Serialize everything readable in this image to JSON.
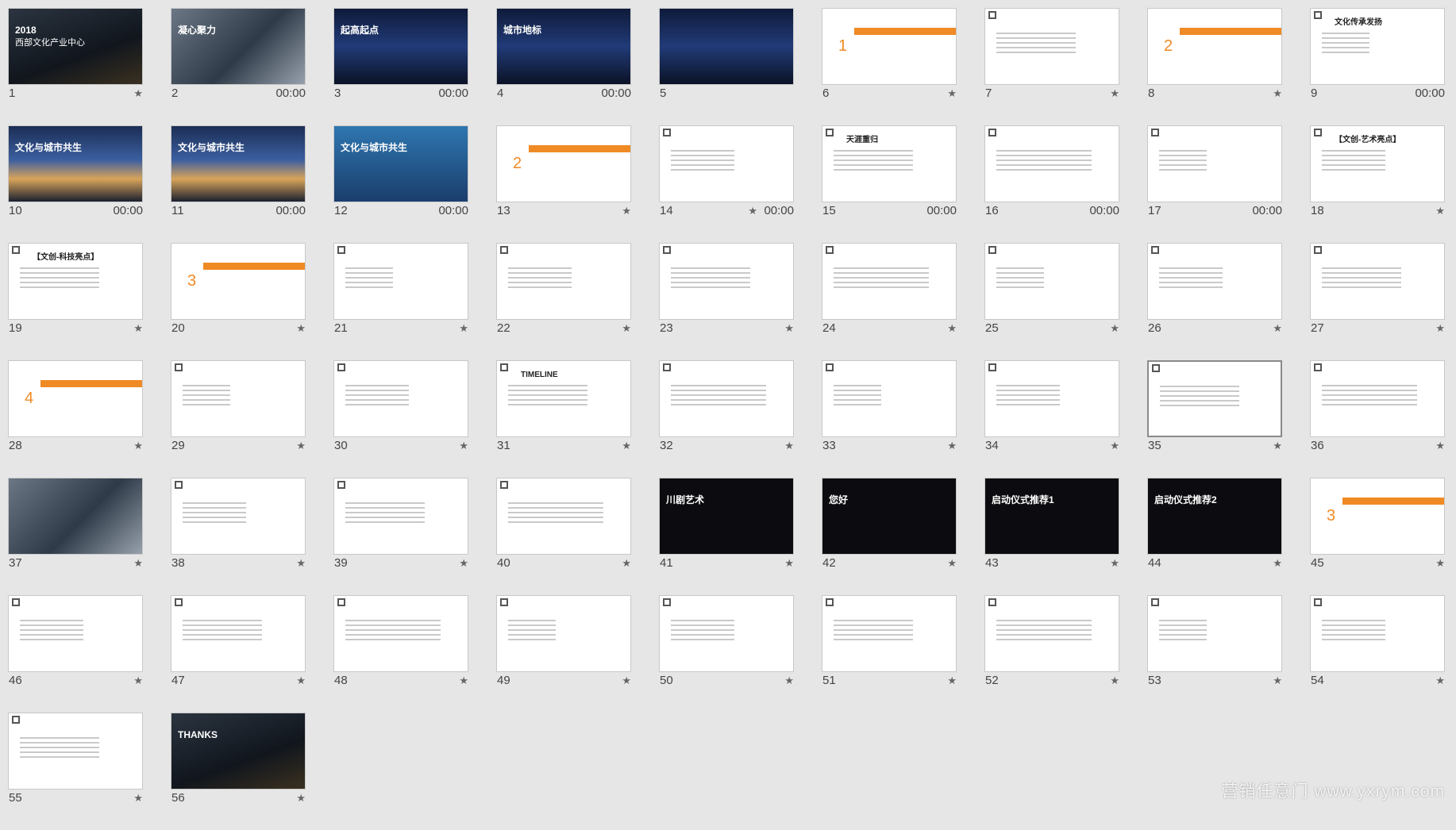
{
  "slides": [
    {
      "n": "1",
      "dur": "",
      "star": true,
      "theme": "dark",
      "title": "2018",
      "subtitle": "西部文化产业中心"
    },
    {
      "n": "2",
      "dur": "00:00",
      "star": false,
      "theme": "photo",
      "title": "凝心聚力"
    },
    {
      "n": "3",
      "dur": "00:00",
      "star": false,
      "theme": "night",
      "title": "起高起点"
    },
    {
      "n": "4",
      "dur": "00:00",
      "star": false,
      "theme": "night",
      "title": "城市地标"
    },
    {
      "n": "5",
      "dur": "",
      "star": false,
      "theme": "night",
      "title": ""
    },
    {
      "n": "6",
      "dur": "",
      "star": true,
      "theme": "part",
      "title": "1"
    },
    {
      "n": "7",
      "dur": "",
      "star": true,
      "theme": "white",
      "title": ""
    },
    {
      "n": "8",
      "dur": "",
      "star": true,
      "theme": "part",
      "title": "2"
    },
    {
      "n": "9",
      "dur": "00:00",
      "star": false,
      "theme": "white",
      "title": "文化传承发扬"
    },
    {
      "n": "10",
      "dur": "00:00",
      "star": false,
      "theme": "city",
      "title": "文化与城市共生"
    },
    {
      "n": "11",
      "dur": "00:00",
      "star": false,
      "theme": "city",
      "title": "文化与城市共生"
    },
    {
      "n": "12",
      "dur": "00:00",
      "star": false,
      "theme": "blue",
      "title": "文化与城市共生"
    },
    {
      "n": "13",
      "dur": "",
      "star": true,
      "theme": "part",
      "title": "2"
    },
    {
      "n": "14",
      "dur": "00:00",
      "star": true,
      "theme": "white",
      "title": ""
    },
    {
      "n": "15",
      "dur": "00:00",
      "star": false,
      "theme": "white",
      "title": "天涯重归"
    },
    {
      "n": "16",
      "dur": "00:00",
      "star": false,
      "theme": "white",
      "title": ""
    },
    {
      "n": "17",
      "dur": "00:00",
      "star": false,
      "theme": "white",
      "title": ""
    },
    {
      "n": "18",
      "dur": "",
      "star": true,
      "theme": "white",
      "title": "【文创-艺术亮点】"
    },
    {
      "n": "19",
      "dur": "",
      "star": true,
      "theme": "white",
      "title": "【文创-科技亮点】"
    },
    {
      "n": "20",
      "dur": "",
      "star": true,
      "theme": "part",
      "title": "3"
    },
    {
      "n": "21",
      "dur": "",
      "star": true,
      "theme": "white",
      "title": ""
    },
    {
      "n": "22",
      "dur": "",
      "star": true,
      "theme": "white",
      "title": ""
    },
    {
      "n": "23",
      "dur": "",
      "star": true,
      "theme": "white",
      "title": ""
    },
    {
      "n": "24",
      "dur": "",
      "star": true,
      "theme": "white",
      "title": ""
    },
    {
      "n": "25",
      "dur": "",
      "star": true,
      "theme": "white",
      "title": ""
    },
    {
      "n": "26",
      "dur": "",
      "star": true,
      "theme": "white",
      "title": ""
    },
    {
      "n": "27",
      "dur": "",
      "star": true,
      "theme": "white",
      "title": ""
    },
    {
      "n": "28",
      "dur": "",
      "star": true,
      "theme": "part",
      "title": "4"
    },
    {
      "n": "29",
      "dur": "",
      "star": true,
      "theme": "white",
      "title": ""
    },
    {
      "n": "30",
      "dur": "",
      "star": true,
      "theme": "white",
      "title": ""
    },
    {
      "n": "31",
      "dur": "",
      "star": true,
      "theme": "white",
      "title": "TIMELINE"
    },
    {
      "n": "32",
      "dur": "",
      "star": true,
      "theme": "white",
      "title": ""
    },
    {
      "n": "33",
      "dur": "",
      "star": true,
      "theme": "white",
      "title": ""
    },
    {
      "n": "34",
      "dur": "",
      "star": true,
      "theme": "white",
      "title": ""
    },
    {
      "n": "35",
      "dur": "",
      "star": true,
      "theme": "white",
      "title": "",
      "selected": true
    },
    {
      "n": "36",
      "dur": "",
      "star": true,
      "theme": "white",
      "title": ""
    },
    {
      "n": "37",
      "dur": "",
      "star": true,
      "theme": "photo",
      "title": ""
    },
    {
      "n": "38",
      "dur": "",
      "star": true,
      "theme": "white",
      "title": ""
    },
    {
      "n": "39",
      "dur": "",
      "star": true,
      "theme": "white",
      "title": ""
    },
    {
      "n": "40",
      "dur": "",
      "star": true,
      "theme": "white",
      "title": ""
    },
    {
      "n": "41",
      "dur": "",
      "star": true,
      "theme": "black",
      "title": "川剧艺术"
    },
    {
      "n": "42",
      "dur": "",
      "star": true,
      "theme": "black",
      "title": "您好"
    },
    {
      "n": "43",
      "dur": "",
      "star": true,
      "theme": "black",
      "title": "启动仪式推荐1"
    },
    {
      "n": "44",
      "dur": "",
      "star": true,
      "theme": "black",
      "title": "启动仪式推荐2"
    },
    {
      "n": "45",
      "dur": "",
      "star": true,
      "theme": "part",
      "title": "3"
    },
    {
      "n": "46",
      "dur": "",
      "star": true,
      "theme": "white",
      "title": ""
    },
    {
      "n": "47",
      "dur": "",
      "star": true,
      "theme": "white",
      "title": ""
    },
    {
      "n": "48",
      "dur": "",
      "star": true,
      "theme": "white",
      "title": ""
    },
    {
      "n": "49",
      "dur": "",
      "star": true,
      "theme": "white",
      "title": ""
    },
    {
      "n": "50",
      "dur": "",
      "star": true,
      "theme": "white",
      "title": ""
    },
    {
      "n": "51",
      "dur": "",
      "star": true,
      "theme": "white",
      "title": ""
    },
    {
      "n": "52",
      "dur": "",
      "star": true,
      "theme": "white",
      "title": ""
    },
    {
      "n": "53",
      "dur": "",
      "star": true,
      "theme": "white",
      "title": ""
    },
    {
      "n": "54",
      "dur": "",
      "star": true,
      "theme": "white",
      "title": ""
    },
    {
      "n": "55",
      "dur": "",
      "star": true,
      "theme": "white",
      "title": ""
    },
    {
      "n": "56",
      "dur": "",
      "star": true,
      "theme": "dark",
      "title": "THANKS"
    }
  ],
  "watermark": "营销任意门 www.yxrym.com",
  "colors": {
    "accent": "#f08a24",
    "background": "#e6e6e6"
  }
}
